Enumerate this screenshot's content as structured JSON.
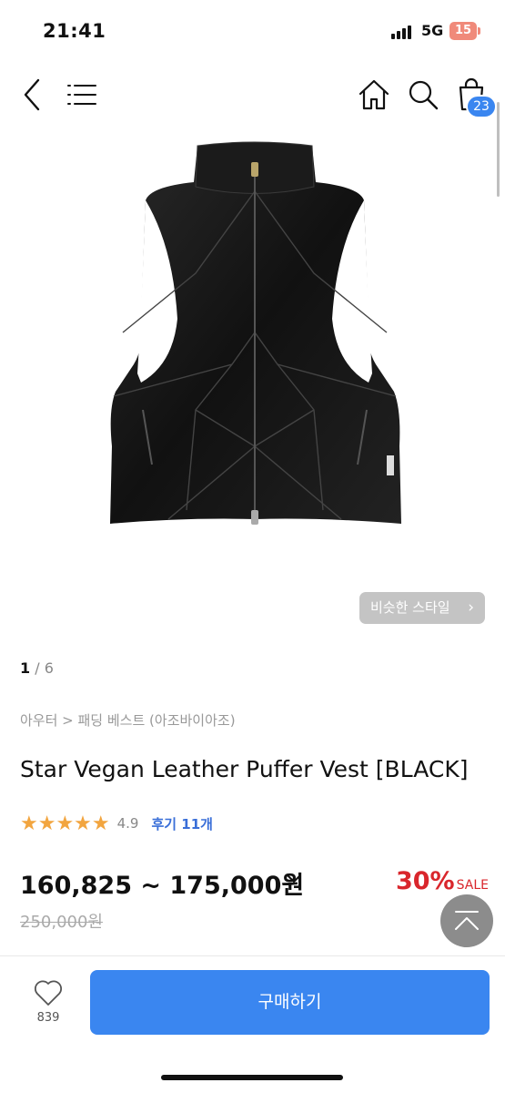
{
  "status_bar": {
    "time": "21:41",
    "network": "5G",
    "battery": "15"
  },
  "nav": {
    "back_icon": "chevron-left-icon",
    "menu_icon": "menu-icon",
    "home_icon": "home-icon",
    "search_icon": "search-icon",
    "cart_icon": "shopping-bag-icon",
    "cart_count": "23"
  },
  "product": {
    "image_alt_icon": "black-leather-puffer-vest-image",
    "similar_style_label": "비슷한 스타일",
    "image_current": "1",
    "image_total": "/ 6",
    "breadcrumb": "아우터 > 패딩 베스트 (아조바이아조)",
    "title": "Star Vegan Leather Puffer Vest [BLACK]",
    "stars": "★★★★★",
    "rating_value": "4.9",
    "review_label": "후기 11개",
    "price_range": "160,825 ~ 175,000원",
    "discount_rate": "30%",
    "sale_label": "SALE",
    "original_price": "250,000원"
  },
  "bottom_bar": {
    "like_count": "839",
    "buy_label": "구매하기"
  },
  "colors": {
    "accent": "#3a86f0",
    "sale": "#d9262c",
    "star": "#f2a53f",
    "review_link": "#3a6fd8"
  }
}
